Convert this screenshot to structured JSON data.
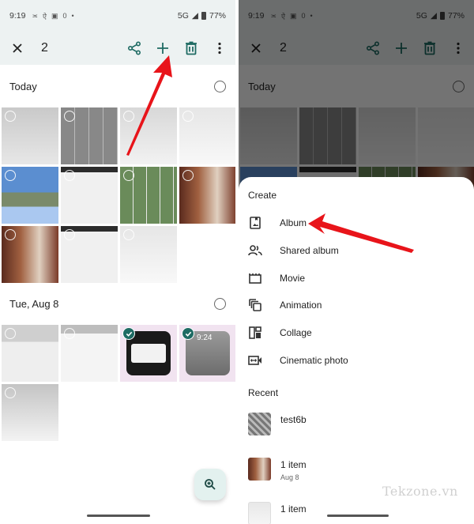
{
  "status_bar": {
    "time": "9:19",
    "network": "5G",
    "battery": "77%",
    "data_speed": "0"
  },
  "toolbar": {
    "close_icon": "close-icon",
    "selected_count": "2",
    "actions": [
      "share-icon",
      "add-icon",
      "delete-icon",
      "more-vert-icon"
    ]
  },
  "left_screen": {
    "sections": [
      {
        "title": "Today",
        "tiles": [
          {
            "kind": "documents",
            "selected": false
          },
          {
            "kind": "grayscale-grid",
            "selected": false
          },
          {
            "kind": "blank-screenshot",
            "selected": false
          },
          {
            "kind": "photos-ui",
            "selected": false
          },
          {
            "kind": "sky-photo",
            "selected": false
          },
          {
            "kind": "create-menu",
            "selected": false
          },
          {
            "kind": "mountain-grid",
            "selected": false
          },
          {
            "kind": "window-keyboard",
            "selected": false
          },
          {
            "kind": "window-photo",
            "selected": false
          },
          {
            "kind": "recent-list",
            "selected": false
          },
          {
            "kind": "details-screen",
            "selected": false
          }
        ]
      },
      {
        "title": "Tue, Aug 8",
        "tiles": [
          {
            "kind": "keyboard-screen",
            "selected": false
          },
          {
            "kind": "chat-list",
            "selected": false
          },
          {
            "kind": "dialog-screenshot",
            "selected": true
          },
          {
            "kind": "homescreen-screenshot",
            "selected": true,
            "clock": "9:24"
          },
          {
            "kind": "faded-screen",
            "selected": false
          }
        ]
      }
    ],
    "fab_icon": "zoom-in-icon"
  },
  "right_screen": {
    "background_section_title": "Today",
    "sheet": {
      "title": "Create",
      "items": [
        {
          "label": "Album",
          "icon": "album-icon"
        },
        {
          "label": "Shared album",
          "icon": "shared-album-icon"
        },
        {
          "label": "Movie",
          "icon": "movie-icon"
        },
        {
          "label": "Animation",
          "icon": "animation-icon"
        },
        {
          "label": "Collage",
          "icon": "collage-icon"
        },
        {
          "label": "Cinematic photo",
          "icon": "cinematic-photo-icon"
        }
      ],
      "recent_title": "Recent",
      "recent": [
        {
          "name": "test6b",
          "date": ""
        },
        {
          "name": "1 item",
          "date": "Aug 8"
        },
        {
          "name": "1 item",
          "date": ""
        }
      ]
    }
  },
  "watermark": "Tekzone.vn",
  "colors": {
    "accent": "#1e6b63",
    "toolbar_bg": "#edf2f2",
    "arrow": "#e8141a",
    "selected_tile_bg": "#f1e3f0"
  }
}
